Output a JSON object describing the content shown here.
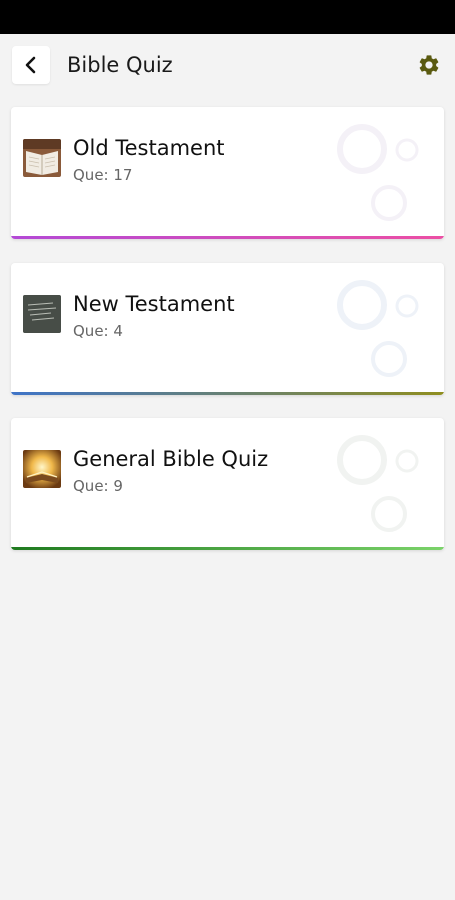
{
  "header": {
    "title": "Bible Quiz"
  },
  "icons": {
    "back": "back-arrow-icon",
    "settings": "gear-icon"
  },
  "colors": {
    "gear": "#5a5a10",
    "background": "#f3f3f3"
  },
  "quizzes": [
    {
      "name": "Old Testament",
      "count": "Que: 17",
      "bar_from": "#b349d6",
      "bar_to": "#ec4fa4"
    },
    {
      "name": "New Testament",
      "count": "Que: 4",
      "bar_from": "#3f74c8",
      "bar_to": "#8f8e1f"
    },
    {
      "name": "General Bible Quiz",
      "count": "Que: 9",
      "bar_from": "#1f7a1f",
      "bar_to": "#7bd36a"
    }
  ]
}
